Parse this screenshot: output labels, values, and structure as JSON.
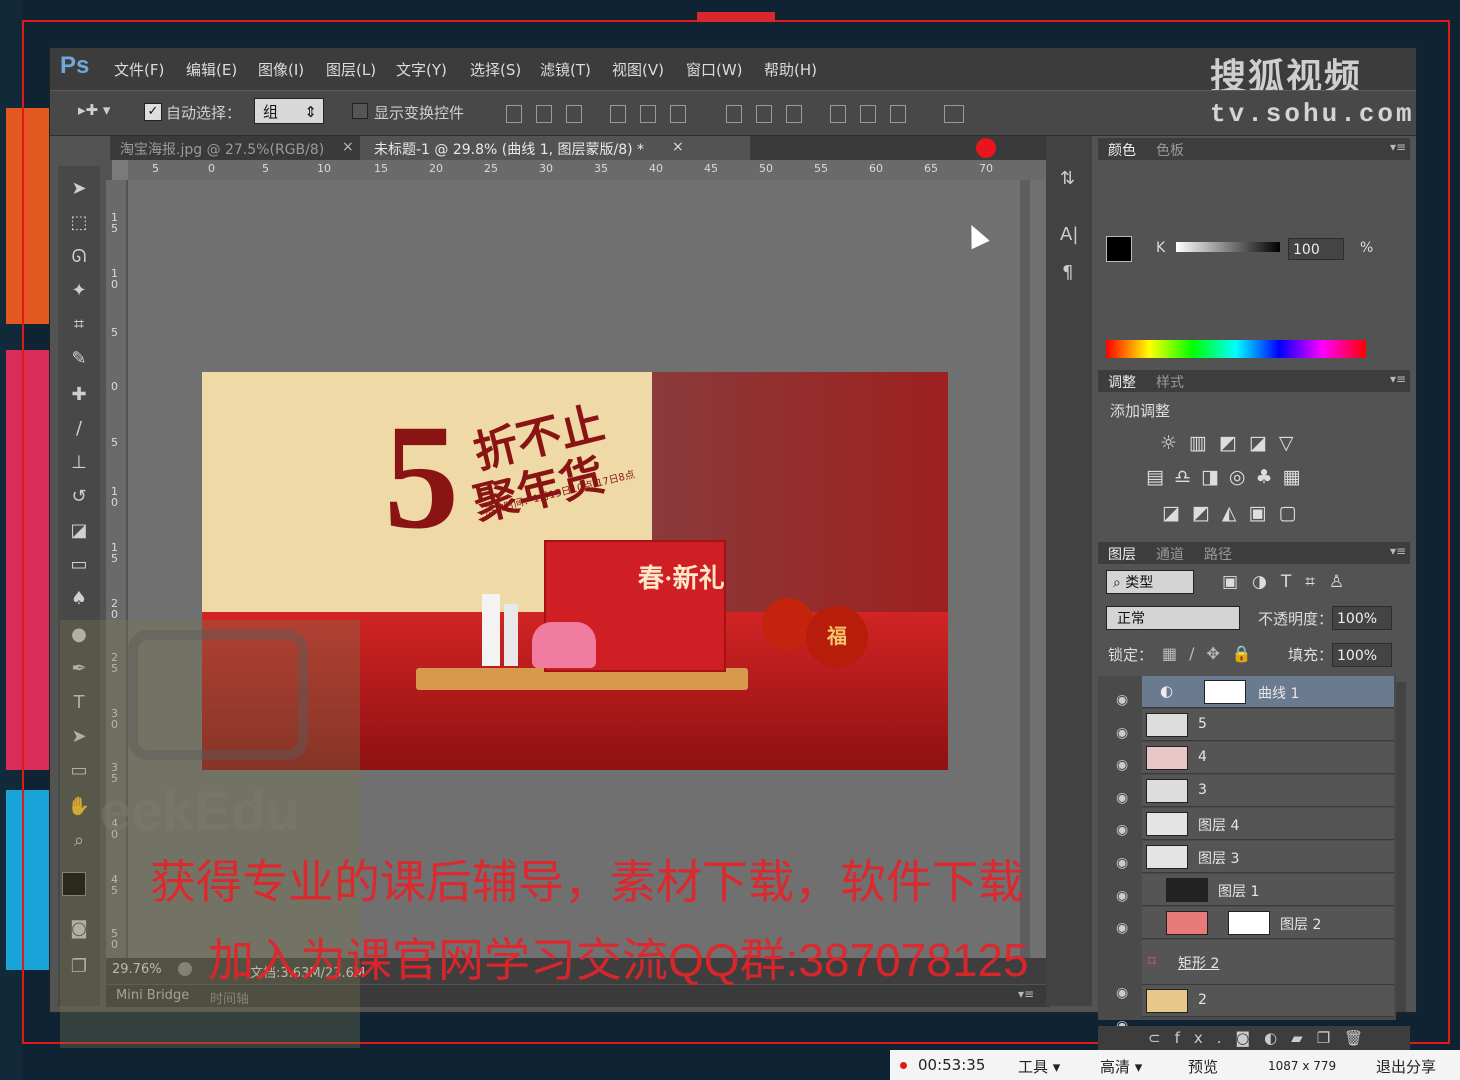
{
  "app": {
    "logo": "Ps"
  },
  "menu": [
    "文件(F)",
    "编辑(E)",
    "图像(I)",
    "图层(L)",
    "文字(Y)",
    "选择(S)",
    "滤镜(T)",
    "视图(V)",
    "窗口(W)",
    "帮助(H)"
  ],
  "options": {
    "auto_select_label": "自动选择：",
    "auto_select_value": "组",
    "show_transform_label": "显示变换控件"
  },
  "doc_tabs": [
    {
      "title": "淘宝海报.jpg @ 27.5%(RGB/8)",
      "close": "×"
    },
    {
      "title": "未标题-1 @ 29.8% (曲线 1, 图层蒙版/8) *",
      "close": "×"
    }
  ],
  "ruler_top": [
    "5",
    "0",
    "5",
    "10",
    "15",
    "20",
    "25",
    "30",
    "35",
    "40",
    "45",
    "50",
    "55",
    "60",
    "65",
    "70"
  ],
  "ruler_left": [
    "1\n5",
    "1\n0",
    "5",
    "0",
    "5",
    "1\n0",
    "1\n5",
    "2\n0",
    "2\n5",
    "3\n0",
    "3\n5",
    "4\n0",
    "4\n5",
    "5\n0"
  ],
  "status": {
    "zoom": "29.76%",
    "doc": "文档:3.63M/23.6M"
  },
  "mini_bridge": {
    "tab1": "Mini Bridge",
    "tab2": "时间轴"
  },
  "watermark": {
    "brand": "搜狐视频",
    "url": "tv.sohu.com"
  },
  "color_panel": {
    "tab1": "颜色",
    "tab2": "色板",
    "channel": "K",
    "value": "100",
    "unit": "%"
  },
  "adjust_panel": {
    "tab1": "调整",
    "tab2": "样式",
    "title": "添加调整"
  },
  "layers_panel": {
    "tab1": "图层",
    "tab2": "通道",
    "tab3": "路径",
    "filter": "类型",
    "blend": "正常",
    "opacity_label": "不透明度：",
    "opacity": "100%",
    "lock_label": "锁定：",
    "fill_label": "填充：",
    "fill": "100%",
    "layers": [
      {
        "name": "曲线 1",
        "selected": true
      },
      {
        "name": "5"
      },
      {
        "name": "4"
      },
      {
        "name": "3"
      },
      {
        "name": "图层 4"
      },
      {
        "name": "图层 3"
      },
      {
        "name": "图层 1"
      },
      {
        "name": "图层 2"
      },
      {
        "name": "矩形 2"
      },
      {
        "name": "2"
      }
    ],
    "footer": "fx."
  },
  "banner": {
    "headline1": "折不止",
    "number": "5",
    "headline2": "聚年货",
    "subtitle": "活动时间：1月15日10点-17日8点",
    "gift": "春·新礼",
    "fu": "福"
  },
  "overlay": {
    "line1": "获得专业的课后辅导，素材下载，软件下载",
    "line2": "加入为课官网学习交流QQ群:387078125",
    "wm": "eekEdu"
  },
  "taskbar": {
    "time": "00:53:35",
    "tools": "工具",
    "quality": "高清",
    "preview": "预览",
    "size": "1087 x 779",
    "exit": "退出分享"
  }
}
